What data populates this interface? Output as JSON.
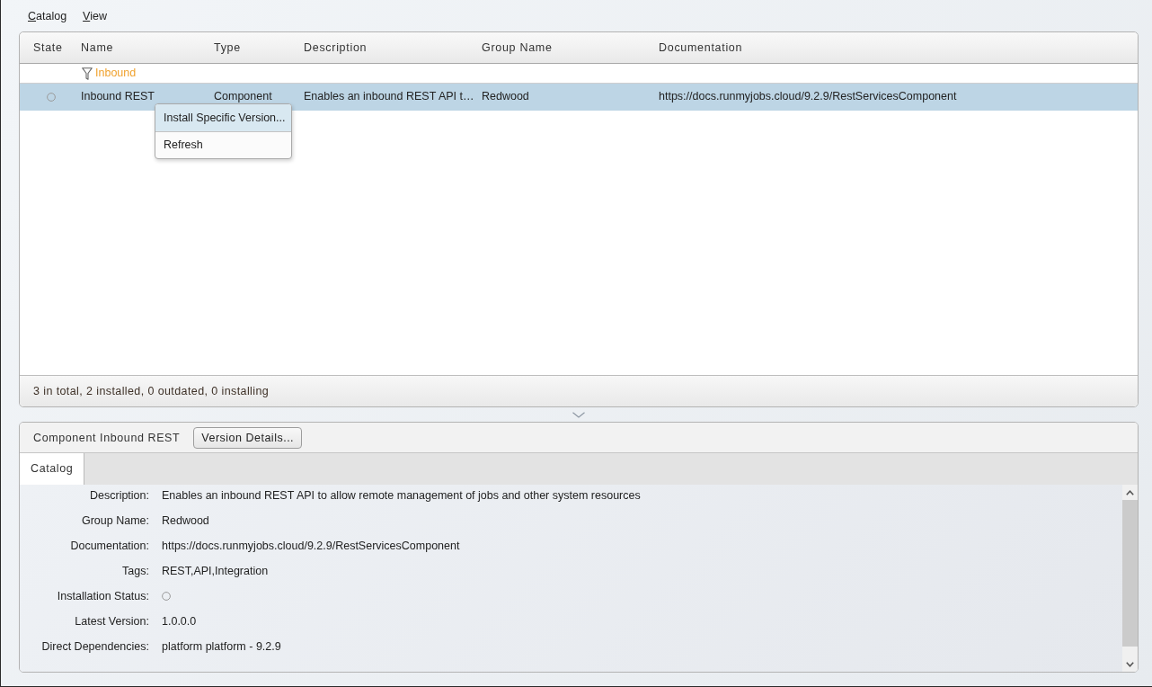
{
  "menu": [
    {
      "label": "Catalog"
    },
    {
      "label": "View"
    }
  ],
  "table": {
    "columns": [
      "State",
      "Name",
      "Type",
      "Description",
      "Group Name",
      "Documentation"
    ],
    "filter": "Inbound",
    "rows": [
      {
        "selected": true,
        "cells": [
          "",
          "Inbound REST",
          "Component",
          "Enables an inbound REST API t…",
          "Redwood",
          "https://docs.runmyjobs.cloud/9.2.9/RestServicesComponent"
        ]
      }
    ]
  },
  "context_menu": [
    {
      "label": "Install Specific Version...",
      "selected": true
    },
    {
      "label": "Refresh",
      "selected": false
    }
  ],
  "status_bar": "3 in total, 2 installed, 0 outdated, 0 installing",
  "details": {
    "title": "Component Inbound REST",
    "button": "Version Details...",
    "tabs": [
      {
        "label": "Catalog",
        "selected": true
      }
    ],
    "properties": [
      {
        "label": "Description:",
        "kind": "text",
        "value": "Enables an inbound REST API to allow remote management of jobs and other system resources"
      },
      {
        "label": "Group Name:",
        "kind": "text",
        "value": "Redwood"
      },
      {
        "label": "Documentation:",
        "kind": "text",
        "value": "https://docs.runmyjobs.cloud/9.2.9/RestServicesComponent"
      },
      {
        "label": "Tags:",
        "kind": "text",
        "value": "REST,API,Integration"
      },
      {
        "label": "Installation Status:",
        "kind": "status"
      },
      {
        "label": "Latest Version:",
        "kind": "text",
        "value": "1.0.0.0"
      },
      {
        "label": "Direct Dependencies:",
        "kind": "text",
        "value": "platform platform - 9.2.9"
      }
    ]
  }
}
